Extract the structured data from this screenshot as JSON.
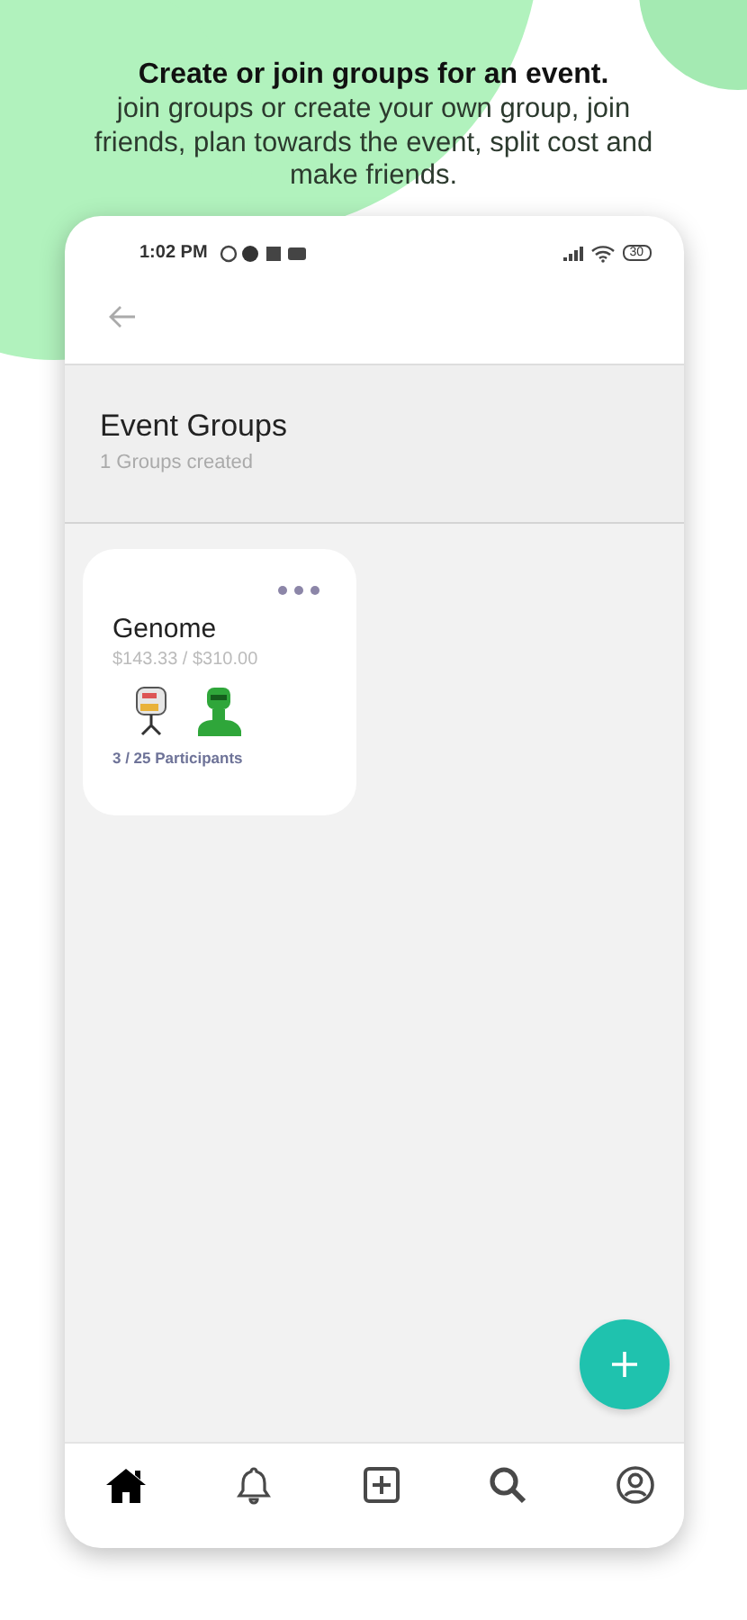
{
  "headline": "Create or join groups for an event.",
  "subtitle": "join groups or create your own group, join friends, plan towards the event, split cost and make friends.",
  "status_bar": {
    "time": "1:02 PM",
    "battery": "30"
  },
  "page": {
    "title": "Event Groups",
    "subtitle": "1 Groups created"
  },
  "groups": [
    {
      "name": "Genome",
      "amount": "$143.33 / $310.00",
      "participants": "3 / 25 Participants",
      "avatars": [
        {
          "kind": "robot"
        },
        {
          "kind": "dino"
        }
      ]
    }
  ],
  "nav": [
    {
      "kind": "home",
      "selected": true
    },
    {
      "kind": "bell",
      "selected": false
    },
    {
      "kind": "add",
      "selected": false
    },
    {
      "kind": "search",
      "selected": false
    },
    {
      "kind": "profile",
      "selected": false
    }
  ]
}
